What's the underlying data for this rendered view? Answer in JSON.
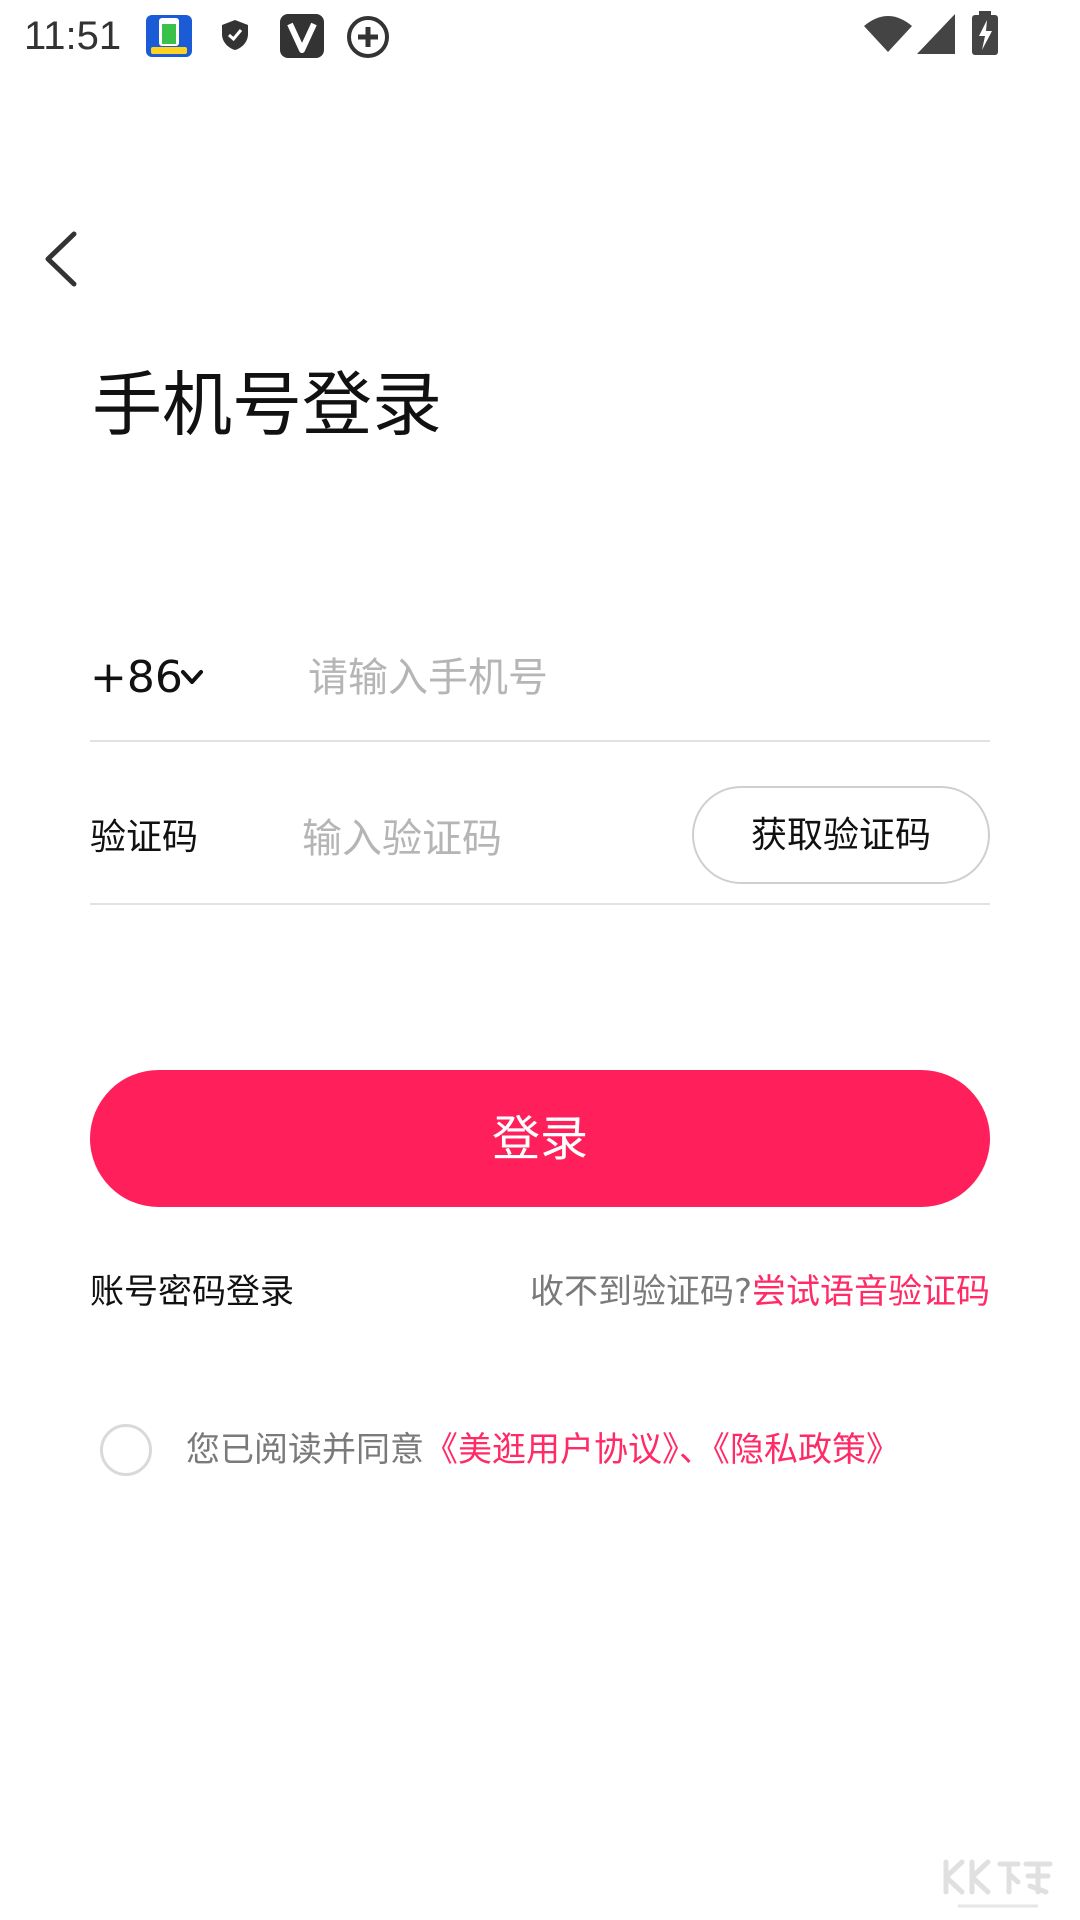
{
  "status_bar": {
    "time": "11:51",
    "icons": [
      "app-icon",
      "shield-icon",
      "v-icon",
      "plus-circle-icon",
      "wifi-icon",
      "signal-icon",
      "battery-charging-icon"
    ]
  },
  "header": {
    "back_icon": "back-arrow-icon",
    "title": "手机号登录"
  },
  "phone": {
    "country_code": "+86",
    "placeholder": "请输入手机号"
  },
  "code": {
    "label": "验证码",
    "placeholder": "输入验证码",
    "get_code_label": "获取验证码"
  },
  "login_button_label": "登录",
  "links": {
    "password_login": "账号密码登录",
    "no_code": "收不到验证码?",
    "voice_code": "尝试语音验证码"
  },
  "agreement": {
    "prefix": "您已阅读并同意",
    "user_agreement": "《美逛用户协议》",
    "separator": "、",
    "privacy_policy": "《隐私政策》"
  },
  "colors": {
    "accent": "#ff1f5b",
    "link": "#ff2a66",
    "placeholder": "#b5b5b5",
    "divider": "#e2e2e2"
  }
}
